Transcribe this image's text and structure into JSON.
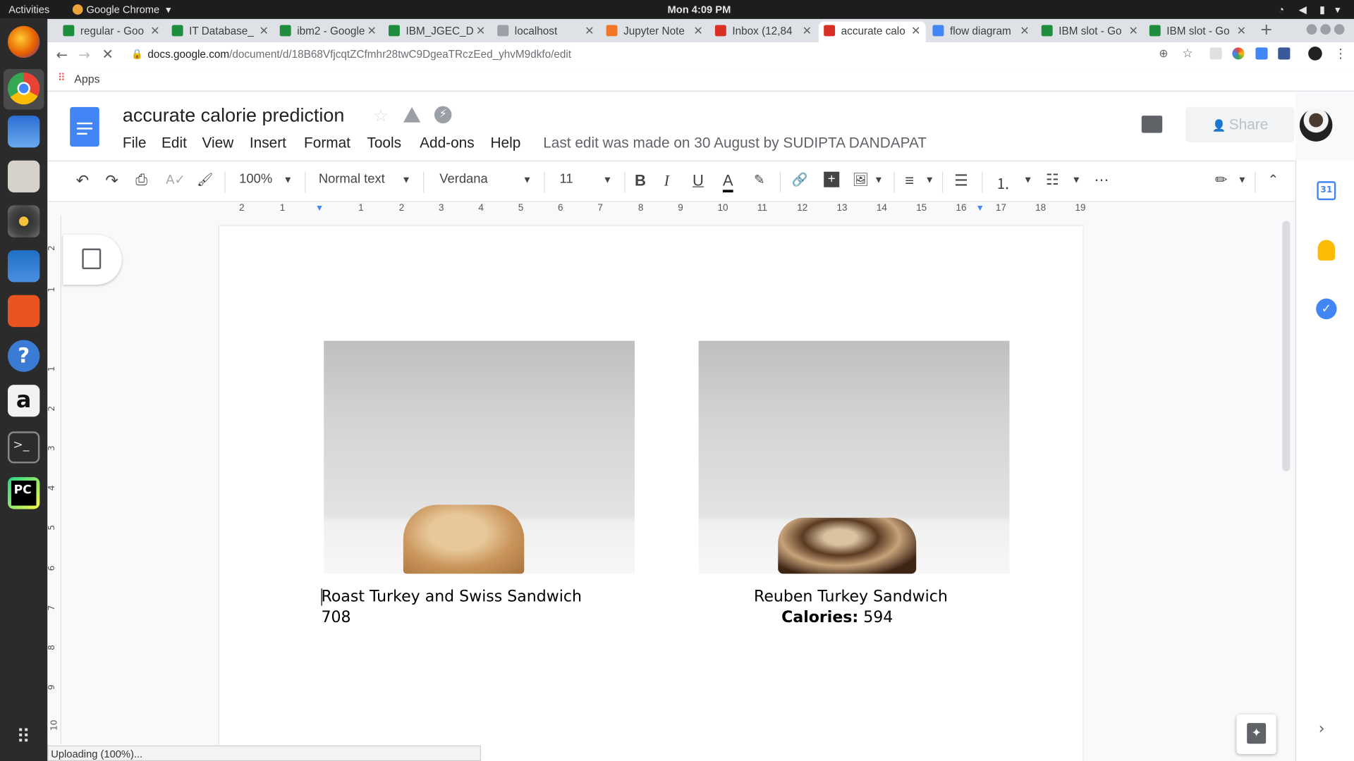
{
  "system_bar": {
    "activities": "Activities",
    "app": "Google Chrome",
    "clock": "Mon  4:09 PM"
  },
  "tabs": [
    {
      "label": "regular - Goo",
      "color": "#1e8e3e"
    },
    {
      "label": "IT Database_",
      "color": "#1e8e3e"
    },
    {
      "label": "ibm2 - Google",
      "color": "#1e8e3e"
    },
    {
      "label": "IBM_JGEC_D",
      "color": "#1e8e3e"
    },
    {
      "label": "localhost",
      "color": "#9aa0a6"
    },
    {
      "label": "Jupyter Note",
      "color": "#f37626"
    },
    {
      "label": "Inbox (12,84",
      "color": "#d93025"
    },
    {
      "label": "accurate calo",
      "color": "#d93025"
    },
    {
      "label": "flow diagram",
      "color": "#4285f4"
    },
    {
      "label": "IBM slot - Go",
      "color": "#1e8e3e"
    },
    {
      "label": "IBM slot - Go",
      "color": "#1e8e3e"
    }
  ],
  "url": {
    "domain": "docs.google.com",
    "path": "/document/d/18B68VfjcqtZCfmhr28twC9DgeaTRczEed_yhvM9dkfo/edit"
  },
  "bookmarks": {
    "apps": "Apps"
  },
  "doc": {
    "title": "accurate calorie prediction",
    "menus": [
      "File",
      "Edit",
      "View",
      "Insert",
      "Format",
      "Tools",
      "Add-ons",
      "Help"
    ],
    "last_edit": "Last edit was made on 30 August by SUDIPTA DANDAPAT",
    "share": "Share"
  },
  "toolbar": {
    "zoom": "100%",
    "style": "Normal text",
    "font": "Verdana",
    "size": "11"
  },
  "ruler": [
    "2",
    "1",
    "1",
    "2",
    "3",
    "4",
    "5",
    "6",
    "7",
    "8",
    "9",
    "10",
    "11",
    "12",
    "13",
    "14",
    "15",
    "16",
    "17",
    "18",
    "19"
  ],
  "vruler": [
    "2",
    "1",
    "1",
    "2",
    "3",
    "4",
    "5",
    "6",
    "7",
    "8",
    "9",
    "10"
  ],
  "content": {
    "left_title": "Roast Turkey and Swiss Sandwich",
    "left_value": "708",
    "right_title": "Reuben Turkey Sandwich",
    "right_calories_label": "Calories:",
    "right_value": "594"
  },
  "status": "Uploading (100%)..."
}
